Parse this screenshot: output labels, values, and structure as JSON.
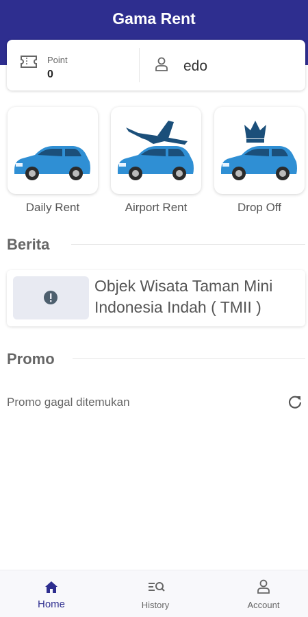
{
  "app": {
    "title": "Gama Rent"
  },
  "colors": {
    "primary": "#2e2e8f",
    "car_blue": "#2f8fd4",
    "background": "#ffffff"
  },
  "account_card": {
    "point_label": "Point",
    "point_value": "0",
    "username": "edo",
    "icons": [
      "ticket-icon",
      "user-icon"
    ]
  },
  "menu": [
    {
      "label": "Daily Rent",
      "icon": "car-icon"
    },
    {
      "label": "Airport Rent",
      "icon": "airplane-car-icon"
    },
    {
      "label": "Drop Off",
      "icon": "crown-car-icon"
    }
  ],
  "news": {
    "section_title": "Berita",
    "items": [
      {
        "title": "Objek Wisata Taman Mini Indonesia Indah ( TMII )",
        "icon": "alert-circle-icon"
      }
    ]
  },
  "promo": {
    "section_title": "Promo",
    "empty_message": "Promo gagal ditemukan",
    "icon": "refresh-icon"
  },
  "bottom_nav": [
    {
      "label": "Home",
      "icon": "home-icon",
      "active": true
    },
    {
      "label": "History",
      "icon": "history-search-icon",
      "active": false
    },
    {
      "label": "Account",
      "icon": "person-icon",
      "active": false
    }
  ]
}
